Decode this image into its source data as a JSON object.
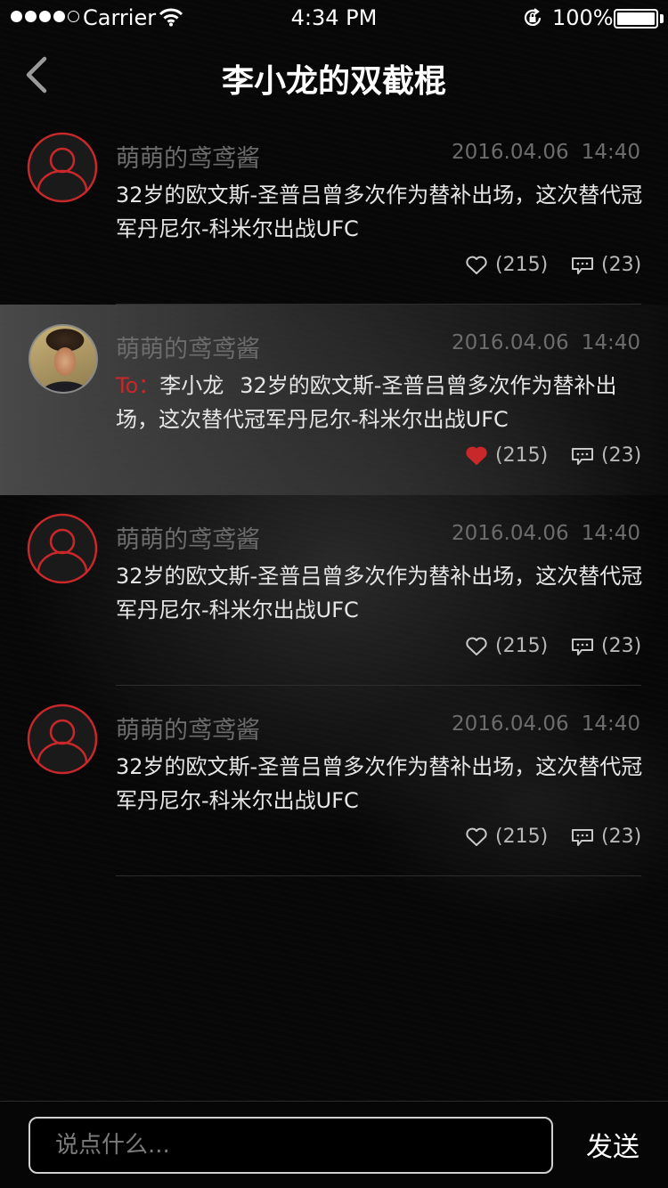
{
  "status_bar": {
    "carrier": "Carrier",
    "time": "4:34 PM",
    "battery_percent": "100%",
    "battery_level": 1.0,
    "signal_bars_filled": 4,
    "signal_bars_total": 5
  },
  "nav": {
    "title": "李小龙的双截棍",
    "back_icon": "chevron-left-icon"
  },
  "colors": {
    "accent": "#c9282b",
    "username": "#6c6c6c",
    "text": "#e6e6e6"
  },
  "comments": [
    {
      "username": "萌萌的鸢鸢酱",
      "date": "2016.04.06",
      "time": "14:40",
      "text": "32岁的欧文斯-圣普吕曾多次作为替补出场，这次替代冠军丹尼尔-科米尔出战UFC",
      "likes": "(215)",
      "replies": "(23)",
      "liked": false,
      "avatar": "default-user-icon"
    },
    {
      "username": "萌萌的鸢鸢酱",
      "date": "2016.04.06",
      "time": "14:40",
      "to_prefix": "To：",
      "to_name": "李小龙",
      "text": "32岁的欧文斯-圣普吕曾多次作为替补出场，这次替代冠军丹尼尔-科米尔出战UFC",
      "likes": "(215)",
      "replies": "(23)",
      "liked": true,
      "avatar": "user-photo"
    },
    {
      "username": "萌萌的鸢鸢酱",
      "date": "2016.04.06",
      "time": "14:40",
      "text": "32岁的欧文斯-圣普吕曾多次作为替补出场，这次替代冠军丹尼尔-科米尔出战UFC",
      "likes": "(215)",
      "replies": "(23)",
      "liked": false,
      "avatar": "default-user-icon"
    },
    {
      "username": "萌萌的鸢鸢酱",
      "date": "2016.04.06",
      "time": "14:40",
      "text": "32岁的欧文斯-圣普吕曾多次作为替补出场，这次替代冠军丹尼尔-科米尔出战UFC",
      "likes": "(215)",
      "replies": "(23)",
      "liked": false,
      "avatar": "default-user-icon"
    }
  ],
  "input": {
    "placeholder": "说点什么...",
    "value": "",
    "send_label": "发送"
  }
}
